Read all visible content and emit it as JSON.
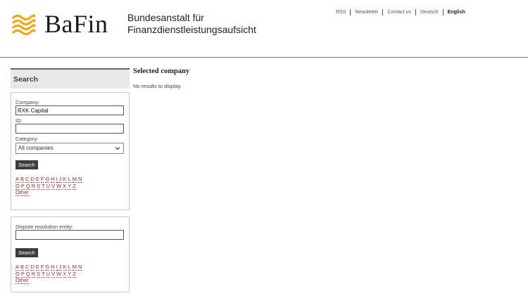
{
  "brand": {
    "logo_text": "BaFin",
    "agency_line1": "Bundesanstalt für",
    "agency_line2": "Finanzdienstleistungsaufsicht"
  },
  "topnav": [
    {
      "label": "RSS"
    },
    {
      "label": "Newsletter"
    },
    {
      "label": "Contact us"
    },
    {
      "label": "Deutsch"
    },
    {
      "label": "English",
      "active": true
    }
  ],
  "sidebar": {
    "title": "Search",
    "company_label": "Company:",
    "company_value": "RXK Capital",
    "id_label": "ID:",
    "id_value": "",
    "category_label": "Category:",
    "category_value": "All companies",
    "search_button": "Search",
    "letters_row1": [
      "A",
      "B",
      "C",
      "D",
      "E",
      "F",
      "G",
      "H",
      "I",
      "J",
      "K",
      "L",
      "M",
      "N"
    ],
    "letters_row2": [
      "O",
      "P",
      "Q",
      "R",
      "S",
      "T",
      "U",
      "V",
      "W",
      "X",
      "Y",
      "Z"
    ],
    "other": "Other",
    "dispute_label": "Dispute resolution entity:",
    "dispute_value": "",
    "search_button2": "Search"
  },
  "main": {
    "title": "Selected company",
    "message": "No results to display."
  },
  "colors": {
    "link": "#8b2a2a",
    "logo_gold": "#f2a71b",
    "button_bg": "#3c3c3c"
  }
}
